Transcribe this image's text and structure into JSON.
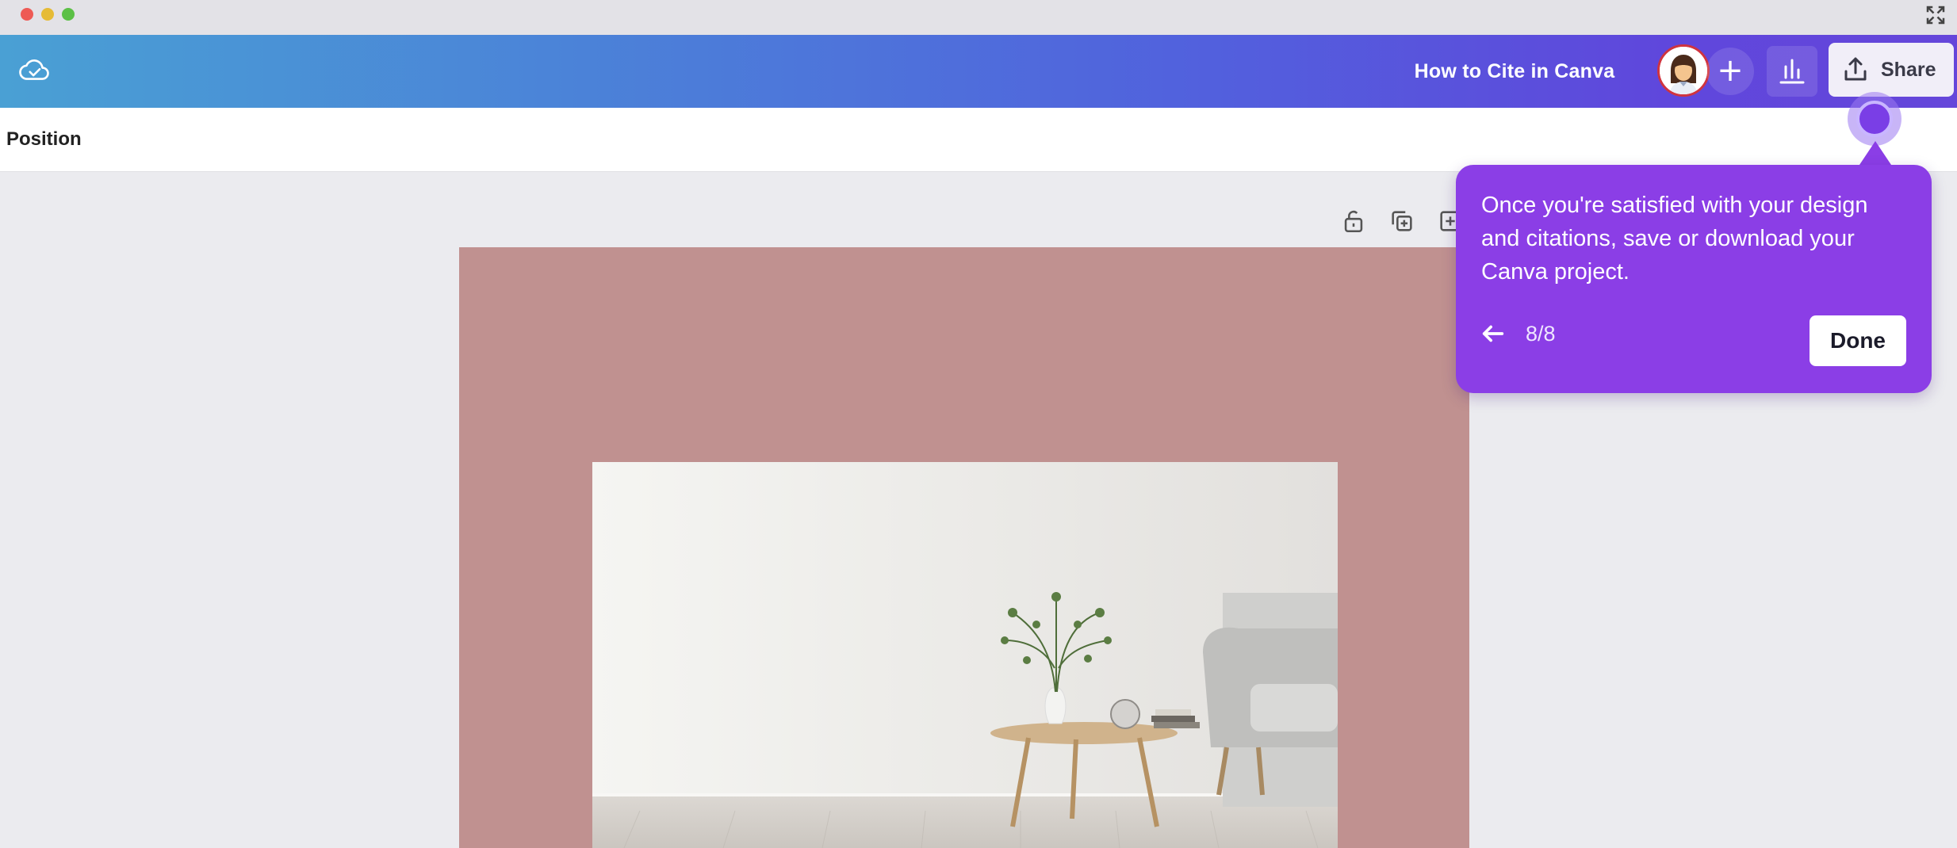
{
  "window": {
    "controls": [
      "close",
      "minimize",
      "maximize"
    ],
    "expand_icon": "expand-icon"
  },
  "topbar": {
    "save_status_icon": "cloud-check-icon",
    "doc_title": "How to Cite in Canva",
    "avatar_icon": "user-avatar",
    "add_icon": "plus-icon",
    "stats_icon": "bar-chart-icon",
    "share_icon": "upload-icon",
    "share_label": "Share"
  },
  "toolbar": {
    "position_label": "Position"
  },
  "page_actions": {
    "icons": [
      "unlock-icon",
      "duplicate-icon",
      "add-page-icon"
    ]
  },
  "canvas": {
    "background_color": "#c09190",
    "image_icon": "living-room-photo"
  },
  "tooltip": {
    "text": "Once you're satisfied with your design and citations, save or download your Canva project.",
    "back_icon": "arrow-left-icon",
    "step": "8/8",
    "done_label": "Done",
    "color": "#8b3ee6"
  }
}
